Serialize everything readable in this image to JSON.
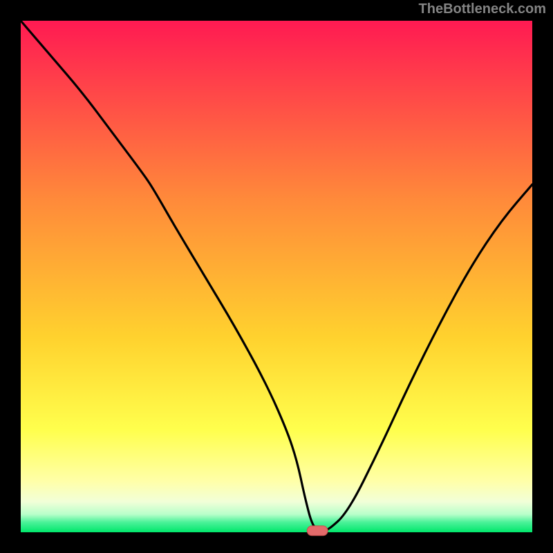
{
  "attribution": "TheBottleneck.com",
  "colors": {
    "border": "#000000",
    "gradient_top": "#ff1a52",
    "gradient_upper": "#ff6a3a",
    "gradient_mid": "#ffd22e",
    "gradient_lower_yellow": "#ffff66",
    "gradient_pale": "#f6ffda",
    "gradient_green": "#00e76b",
    "line": "#000000",
    "marker_fill": "#e26a6a",
    "marker_stroke": "#c94d4d"
  },
  "chart_data": {
    "type": "line",
    "title": "",
    "xlabel": "",
    "ylabel": "",
    "xlim": [
      0,
      100
    ],
    "ylim": [
      0,
      100
    ],
    "x": [
      0,
      6,
      12,
      18,
      24,
      26,
      30,
      36,
      42,
      48,
      52,
      54,
      55.5,
      57,
      58.5,
      60,
      64,
      70,
      76,
      82,
      88,
      94,
      100
    ],
    "values": [
      100,
      93,
      86,
      78,
      70,
      67,
      60,
      50,
      40,
      29,
      20,
      14,
      7,
      1.2,
      0.3,
      0.3,
      4,
      16,
      29,
      41,
      52,
      61,
      68
    ],
    "marker": {
      "x": 58,
      "y": 0.3
    },
    "notes": "V-shaped bottleneck curve; minimum near x≈58% with value ≈0. Values are percent bottleneck read against the full plot height (0 at bottom green band, 100 at top)."
  }
}
